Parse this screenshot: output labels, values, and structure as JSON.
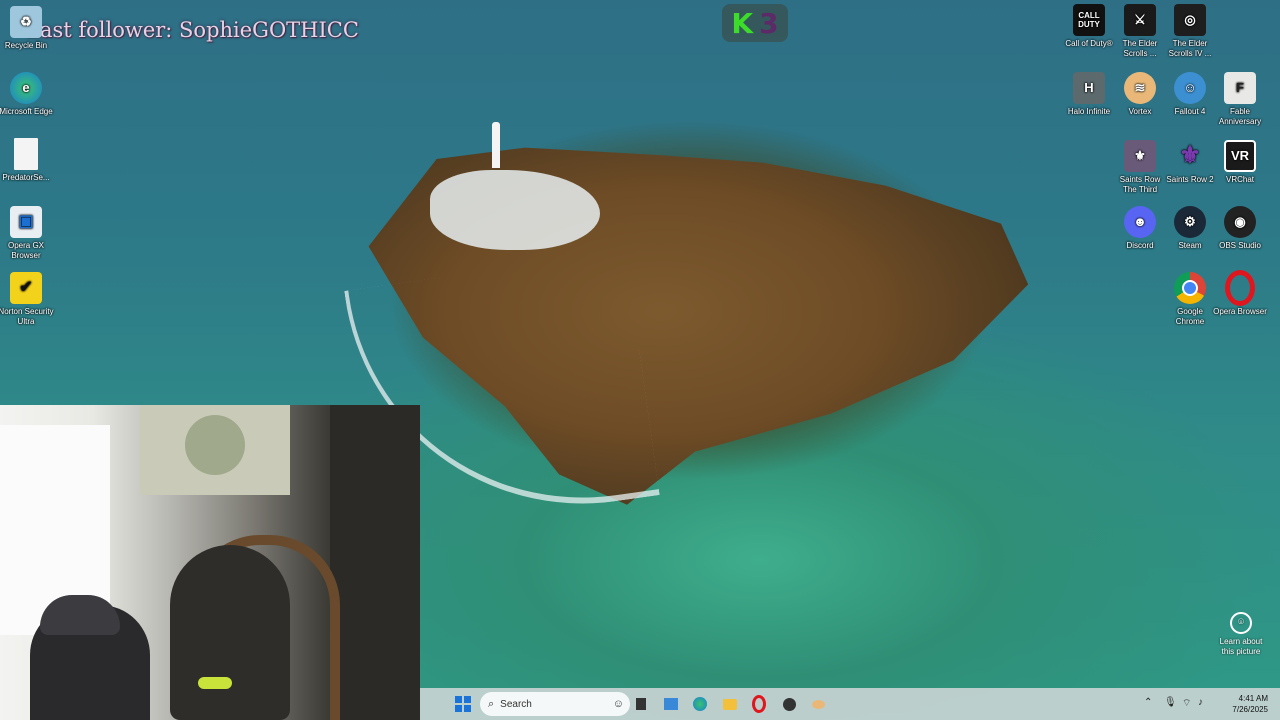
{
  "stream_overlay": {
    "follower_text": "Last follower: SophieGOTHICC",
    "badge_letter": "K",
    "badge_number": "3"
  },
  "desktop_icons_left": [
    {
      "label": "Recycle Bin",
      "icon": "recycle-bin-icon"
    },
    {
      "label": "Microsoft Edge",
      "icon": "edge-icon"
    },
    {
      "label": "PredatorSe...",
      "icon": "file-icon"
    },
    {
      "label": "Opera GX Browser",
      "icon": "opera-gx-icon"
    },
    {
      "label": "Norton Security Ultra",
      "icon": "norton-icon"
    }
  ],
  "desktop_icons_right": [
    {
      "label": "Call of Duty®",
      "icon": "call-of-duty-icon"
    },
    {
      "label": "The Elder Scrolls ...",
      "icon": "elder-scrolls-icon"
    },
    {
      "label": "The Elder Scrolls IV ...",
      "icon": "oblivion-icon"
    },
    {
      "label": "Halo Infinite",
      "icon": "halo-icon"
    },
    {
      "label": "Vortex",
      "icon": "vortex-icon"
    },
    {
      "label": "Fallout 4",
      "icon": "fallout-icon"
    },
    {
      "label": "Fable Anniversary",
      "icon": "fable-icon"
    },
    {
      "label": "Saints Row The Third",
      "icon": "saints-row-3-icon"
    },
    {
      "label": "Saints Row 2",
      "icon": "saints-row-2-icon"
    },
    {
      "label": "VRChat",
      "icon": "vrchat-icon"
    },
    {
      "label": "Discord",
      "icon": "discord-icon"
    },
    {
      "label": "Steam",
      "icon": "steam-icon"
    },
    {
      "label": "OBS Studio",
      "icon": "obs-icon"
    },
    {
      "label": "Google Chrome",
      "icon": "chrome-icon"
    },
    {
      "label": "Opera Browser",
      "icon": "opera-icon"
    }
  ],
  "learn": {
    "label": "Learn about this picture"
  },
  "taskbar": {
    "search_placeholder": "Search",
    "time": "4:41 AM",
    "date": "7/26/2025"
  }
}
